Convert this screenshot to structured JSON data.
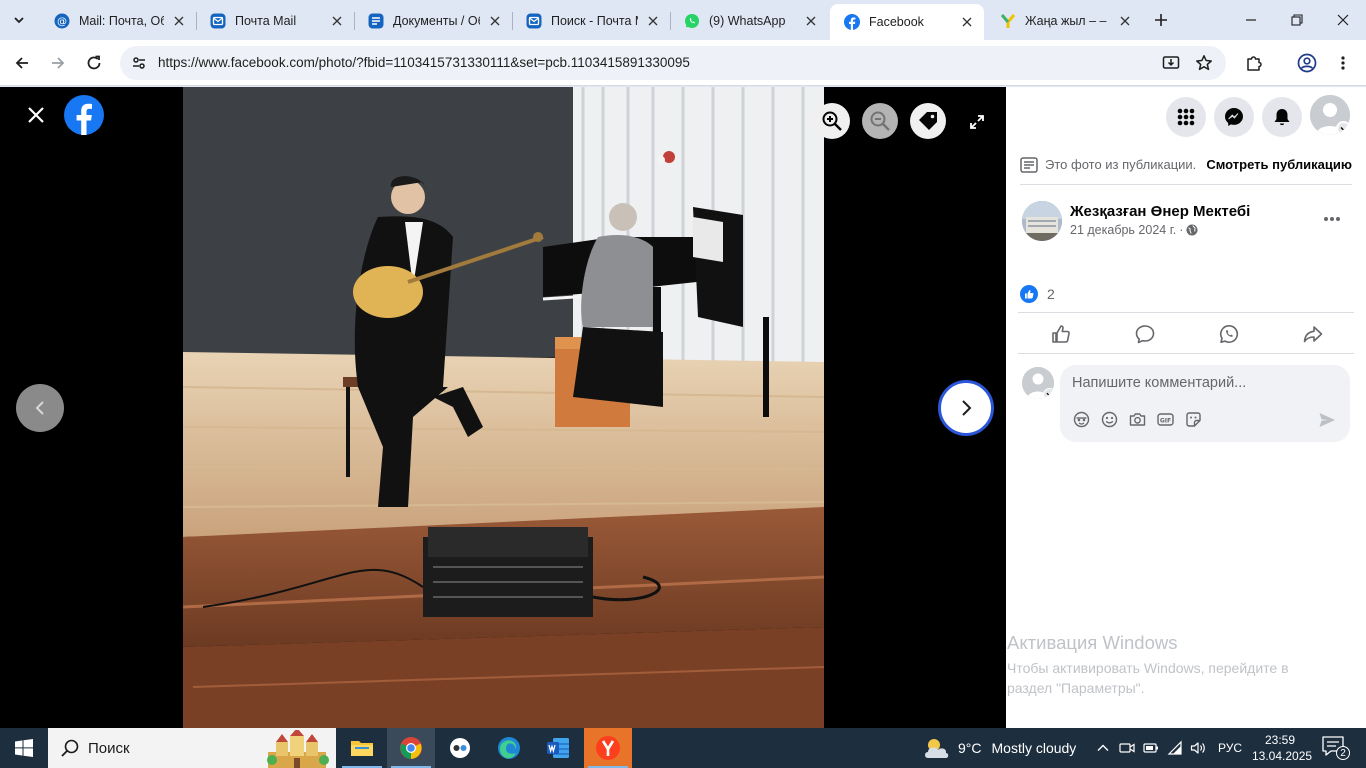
{
  "browser": {
    "tabs": [
      {
        "title": "Mail: Почта, Обл",
        "favicon": "mail-ru-icon"
      },
      {
        "title": "Почта Mail",
        "favicon": "mail-envelope-icon"
      },
      {
        "title": "Документы / Об",
        "favicon": "docs-icon"
      },
      {
        "title": "Поиск - Почта М",
        "favicon": "mail-envelope-icon"
      },
      {
        "title": "(9) WhatsApp",
        "favicon": "whatsapp-icon"
      },
      {
        "title": "Facebook",
        "favicon": "facebook-icon",
        "active": true
      },
      {
        "title": "Жаңа жыл – – п",
        "favicon": "yandex-icon"
      }
    ],
    "url": "https://www.facebook.com/photo/?fbid=1103415731330111&set=pcb.1103415891330095"
  },
  "post_panel": {
    "from_post_label": "Это фото из публикации.",
    "view_post_link": "Смотреть публикацию",
    "author": "Жезқазған Өнер Мектебі",
    "date": "21 декабрь 2024 г.",
    "date_separator": "·",
    "reaction_count": "2",
    "comment_placeholder": "Напишите комментарий..."
  },
  "watermark": {
    "title": "Активация Windows",
    "line1": "Чтобы активировать Windows, перейдите в",
    "line2": "раздел \"Параметры\"."
  },
  "taskbar": {
    "search_placeholder": "Поиск",
    "temperature": "9°C",
    "weather": "Mostly cloudy",
    "language": "РУС",
    "time": "23:59",
    "date": "13.04.2025",
    "notification_count": "2"
  },
  "colors": {
    "facebook_blue": "#1877f2",
    "browser_frame": "#dfe7f4",
    "taskbar": "#1d2e3e"
  }
}
